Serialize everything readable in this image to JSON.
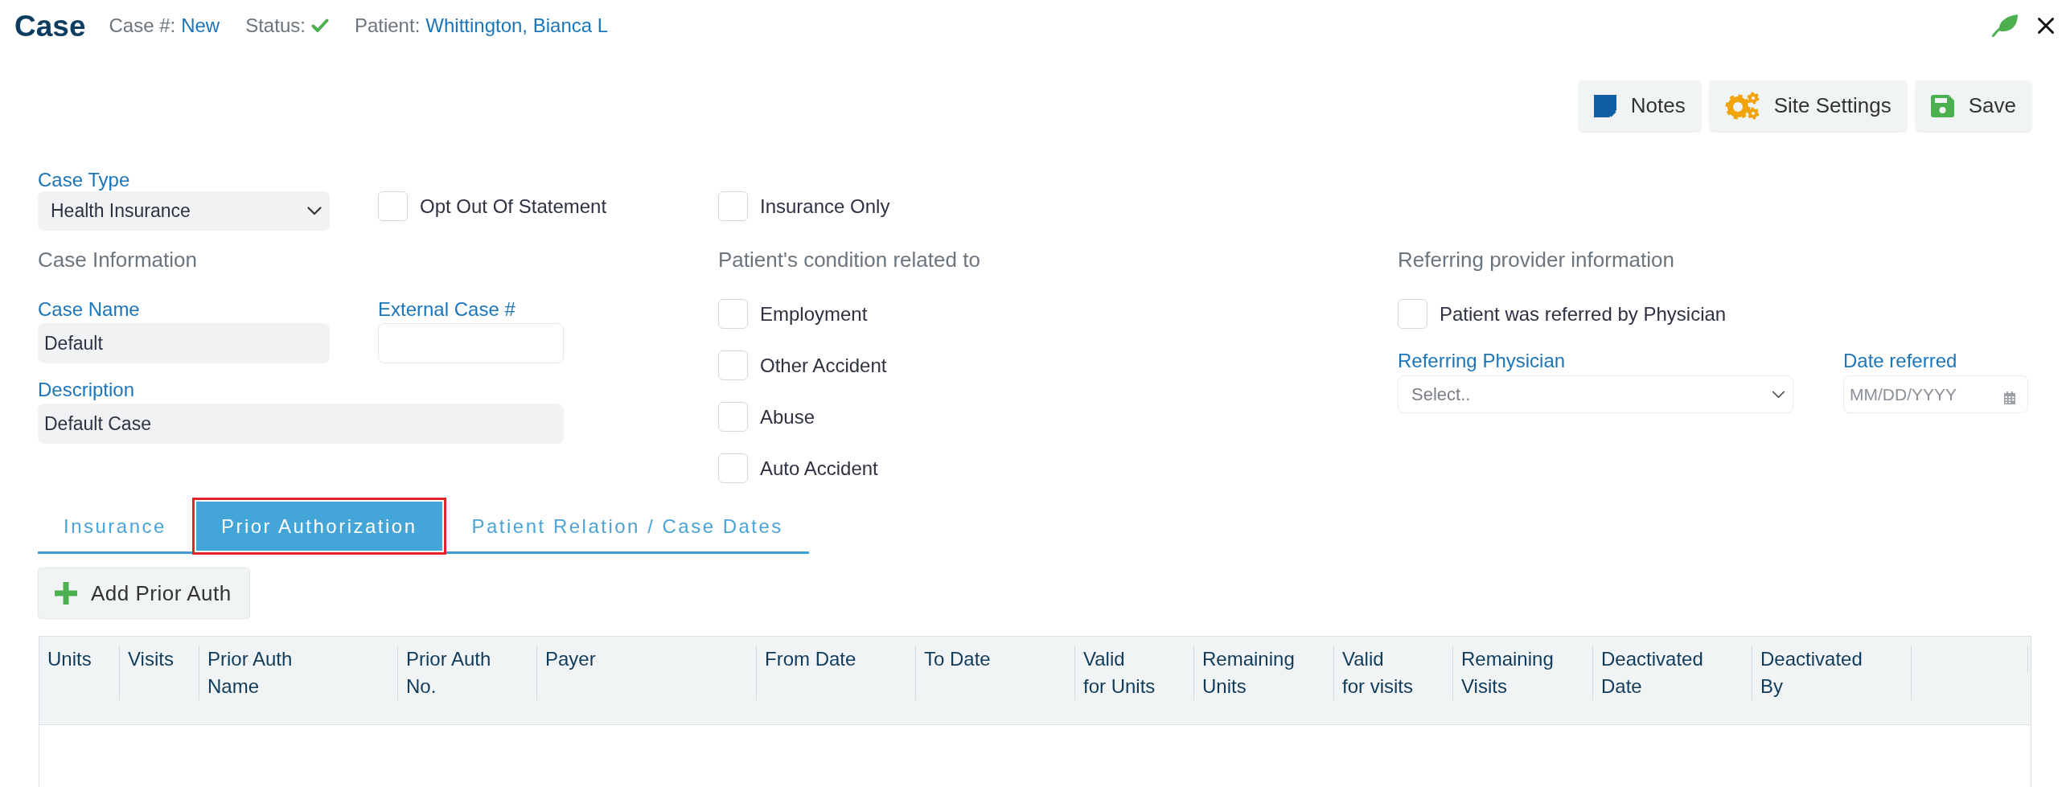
{
  "header": {
    "title": "Case",
    "fields": [
      {
        "kind": "text",
        "label": "Case #:",
        "value": "New"
      },
      {
        "kind": "status",
        "label": "Status:"
      },
      {
        "kind": "text",
        "label": "Patient:",
        "value": "Whittington, Bianca L"
      }
    ]
  },
  "toolbar": [
    {
      "kind": "notes",
      "label": "Notes"
    },
    {
      "kind": "settings",
      "label": "Site Settings"
    },
    {
      "kind": "save",
      "label": "Save"
    }
  ],
  "case_type": {
    "label": "Case Type",
    "value": "Health Insurance",
    "disabled": true
  },
  "top_options": [
    {
      "label": "Opt Out Of Statement",
      "checked": false
    },
    {
      "label": "Insurance Only",
      "checked": false
    }
  ],
  "case_information": {
    "title": "Case Information",
    "fields": [
      {
        "label": "Case Name",
        "value": "Default",
        "disabled": true
      },
      {
        "label": "External Case #",
        "disabled": false
      },
      {
        "label": "Description",
        "value": "Default Case",
        "disabled": true
      }
    ]
  },
  "condition": {
    "title": "Patient's condition related to",
    "options": [
      {
        "label": "Employment",
        "checked": false
      },
      {
        "label": "Other Accident",
        "checked": false
      },
      {
        "label": "Abuse",
        "checked": false
      },
      {
        "label": "Auto Accident",
        "checked": false
      }
    ]
  },
  "referring": {
    "title": "Referring provider information",
    "referred": {
      "label": "Patient was referred by Physician",
      "checked": false
    },
    "physician": {
      "label": "Referring Physician",
      "placeholder": "Select..",
      "disabled": false
    },
    "date": {
      "label": "Date referred",
      "placeholder": "MM/DD/YYYY"
    }
  },
  "tabs": [
    {
      "label": "Insurance",
      "selected": false,
      "highlighted": false
    },
    {
      "label": "Prior Authorization",
      "selected": true,
      "highlighted": true
    },
    {
      "label": "Patient Relation / Case Dates",
      "selected": false,
      "highlighted": false
    }
  ],
  "add_button": {
    "label": "Add Prior Auth"
  },
  "table": {
    "columns": [
      {
        "lines": [
          "Units"
        ]
      },
      {
        "lines": [
          "Visits"
        ]
      },
      {
        "lines": [
          "Prior Auth",
          "Name"
        ]
      },
      {
        "lines": [
          "Prior Auth",
          "No."
        ]
      },
      {
        "lines": [
          "Payer"
        ]
      },
      {
        "lines": [
          "From Date"
        ]
      },
      {
        "lines": [
          "To Date"
        ]
      },
      {
        "lines": [
          "Valid",
          "for Units"
        ]
      },
      {
        "lines": [
          "Remaining",
          "Units"
        ]
      },
      {
        "lines": [
          "Valid",
          "for visits"
        ]
      },
      {
        "lines": [
          "Remaining",
          "Visits"
        ]
      },
      {
        "lines": [
          "Deactivated",
          "Date"
        ]
      },
      {
        "lines": [
          "Deactivated",
          "By"
        ]
      }
    ]
  }
}
